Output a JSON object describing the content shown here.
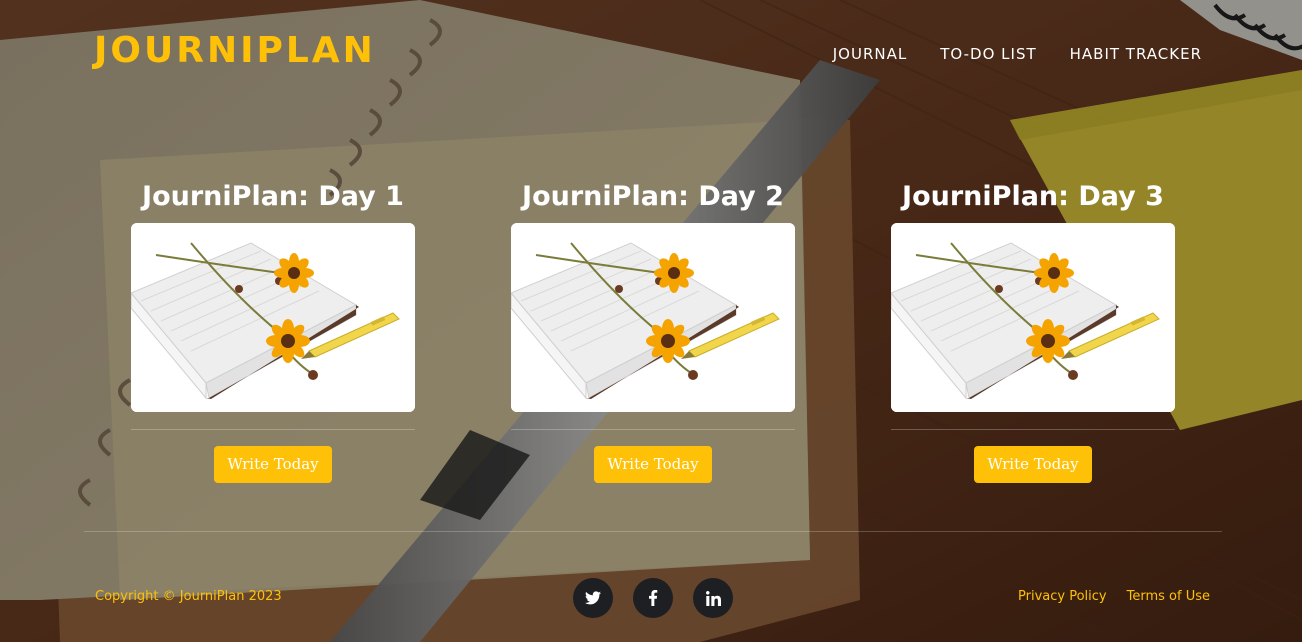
{
  "header": {
    "brand": "JOURNIPLAN",
    "nav": [
      "JOURNAL",
      "TO-DO LIST",
      "HABIT TRACKER"
    ]
  },
  "cards": [
    {
      "title": "JourniPlan: Day 1",
      "button": "Write Today"
    },
    {
      "title": "JourniPlan: Day 2",
      "button": "Write Today"
    },
    {
      "title": "JourniPlan: Day 3",
      "button": "Write Today"
    }
  ],
  "footer": {
    "copyright": "Copyright © JourniPlan 2023",
    "social_icons": [
      "twitter-icon",
      "facebook-icon",
      "linkedin-icon"
    ],
    "social_glyphs": {
      "twitter": "🐦",
      "facebook": "f",
      "linkedin": "in"
    },
    "links": [
      "Privacy Policy",
      "Terms of Use"
    ]
  },
  "colors": {
    "accent": "#ffc107",
    "icon_circle": "#1d1f22",
    "text": "#ffffff"
  }
}
